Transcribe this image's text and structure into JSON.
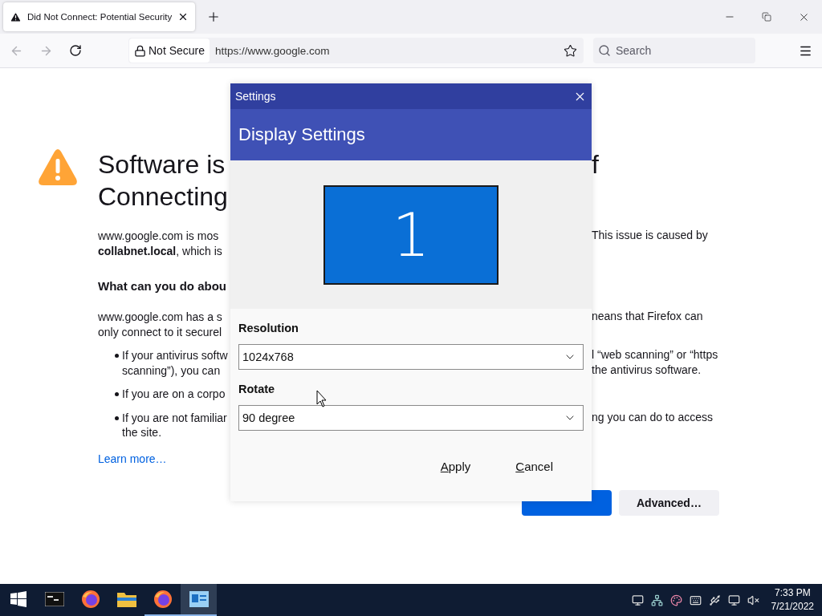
{
  "browser": {
    "tab": {
      "title": "Did Not Connect: Potential Security"
    },
    "security_label": "Not Secure",
    "url": "https://www.google.com",
    "search": {
      "placeholder": "Search"
    }
  },
  "page": {
    "lines": [
      {
        "kind": "heading",
        "left": "Software is",
        "right": "f"
      },
      {
        "kind": "heading_cont",
        "left": "Connecting"
      },
      {
        "kind": "text",
        "left": "www.google.com is mos",
        "right": "This issue is caused by"
      },
      {
        "kind": "text_cont",
        "left": "**collabnet.local**, which is"
      },
      {
        "kind": "subheading",
        "left": "What can you do abou"
      },
      {
        "kind": "text",
        "left": "www.google.com has a s",
        "right": "neans that Firefox can"
      },
      {
        "kind": "text_cont",
        "left": "only connect to it securel"
      },
      {
        "kind": "bullet",
        "left": "If your antivirus softw",
        "right": "l “web scanning” or “https"
      },
      {
        "kind": "bullet_cont",
        "left": "scanning”), you can",
        "right": "the antivirus software."
      },
      {
        "kind": "bullet",
        "left": "If you are on a corpo"
      },
      {
        "kind": "bullet",
        "left": "If you are not familiar",
        "right": "ng you can do to access"
      },
      {
        "kind": "bullet_cont",
        "left": "the site."
      },
      {
        "kind": "link",
        "left": "Learn more…"
      }
    ],
    "actions": [
      {
        "kind": "primary"
      },
      {
        "kind": "secondary",
        "label": "Advanced…"
      }
    ]
  },
  "dialog": {
    "title": "Settings",
    "header": "Display Settings",
    "monitor_number": "1",
    "fields": [
      {
        "label": "Resolution",
        "value": "1024x768"
      },
      {
        "label": "Rotate",
        "value": "90 degree"
      }
    ],
    "buttons": [
      "Apply",
      "Cancel"
    ]
  },
  "taskbar": {
    "apps": [
      {
        "kind": "terminal",
        "running": false,
        "selected": false
      },
      {
        "kind": "browser",
        "running": false,
        "selected": false
      },
      {
        "kind": "folder",
        "running": false,
        "selected": false
      },
      {
        "kind": "browser",
        "running": true,
        "selected": false
      },
      {
        "kind": "display",
        "running": true,
        "selected": true
      }
    ],
    "time": "7:33 PM",
    "date": "7/21/2022"
  }
}
